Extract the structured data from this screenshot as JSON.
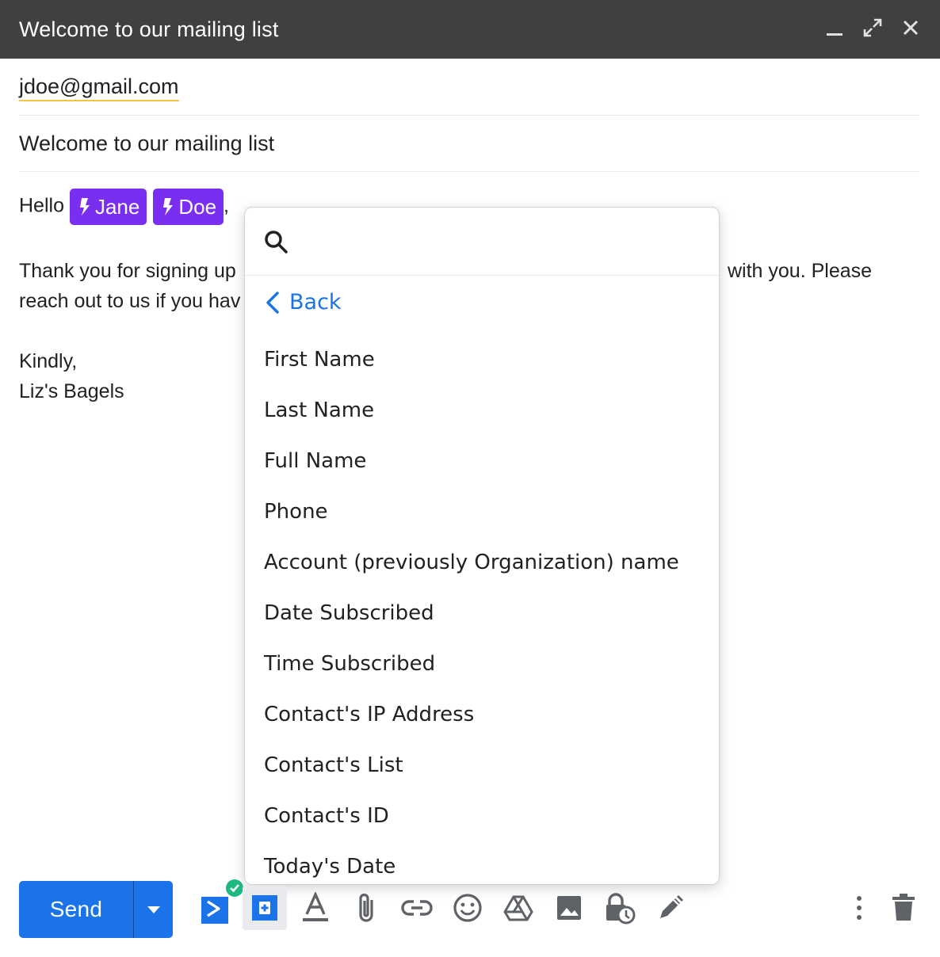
{
  "window": {
    "title": "Welcome to our mailing list"
  },
  "compose": {
    "to": "jdoe@gmail.com",
    "subject": "Welcome to our mailing list",
    "body": {
      "greeting": "Hello",
      "chips": [
        "Jane",
        "Doe"
      ],
      "comma": ",",
      "line1_left": "Thank you for signing up",
      "line1_right": "with you. Please",
      "line2_left": "reach out to us if you hav",
      "signoff": "Kindly,",
      "signature": "Liz's Bagels"
    }
  },
  "popup": {
    "search_placeholder": "",
    "back_label": "Back",
    "items": [
      "First Name",
      "Last Name",
      "Full Name",
      "Phone",
      "Account (previously Organization) name",
      "Date Subscribed",
      "Time Subscribed",
      "Contact's IP Address",
      "Contact's List",
      "Contact's ID",
      "Today's Date"
    ]
  },
  "toolbar": {
    "send_label": "Send",
    "colors": {
      "accent": "#1a73e8",
      "chip": "#7a2ff0",
      "titlebar": "#404040"
    },
    "tools": [
      "activecampaign-icon",
      "personalize-icon",
      "text-format-icon",
      "attach-icon",
      "link-icon",
      "emoji-icon",
      "drive-icon",
      "image-icon",
      "confidential-icon",
      "signature-icon",
      "more-options-icon",
      "delete-icon"
    ]
  }
}
